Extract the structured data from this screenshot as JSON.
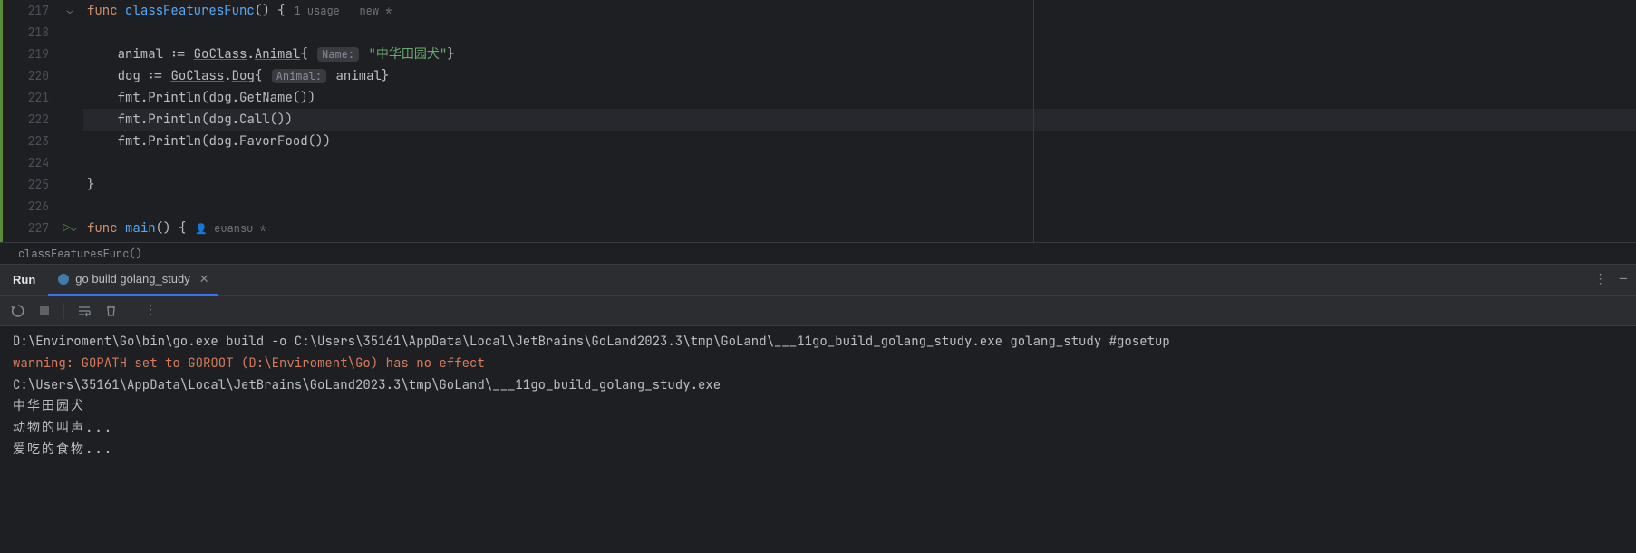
{
  "editor": {
    "lines": [
      217,
      218,
      219,
      220,
      221,
      222,
      223,
      224,
      225,
      226,
      227
    ],
    "current_line": 222,
    "func_decl": {
      "kw_func": "func",
      "name": "classFeaturesFunc",
      "parens": "()",
      "brace": "{",
      "usage": "1 usage",
      "status": "new *"
    },
    "l219": {
      "var": "animal",
      "assign": ":=",
      "pkg": "GoClass",
      "type": "Animal",
      "hint": "Name:",
      "str": "\"中华田园犬\""
    },
    "l220": {
      "var": "dog",
      "assign": ":=",
      "pkg": "GoClass",
      "type": "Dog",
      "hint": "Animal:",
      "val": "animal"
    },
    "l221": {
      "pkg": "fmt",
      "fn": "Println",
      "obj": "dog",
      "method": "GetName"
    },
    "l222": {
      "pkg": "fmt",
      "fn": "Println",
      "obj": "dog",
      "method": "Call"
    },
    "l223": {
      "pkg": "fmt",
      "fn": "Println",
      "obj": "dog",
      "method": "FavorFood"
    },
    "l225": {
      "brace": "}"
    },
    "l227": {
      "kw_func": "func",
      "name": "main",
      "parens": "()",
      "brace": "{",
      "author": "euansu *"
    }
  },
  "breadcrumb": "classFeaturesFunc()",
  "tool_window": {
    "title": "Run",
    "tab_label": "go build golang_study"
  },
  "console": {
    "lines": [
      {
        "cls": "out-normal",
        "text": "D:\\Enviroment\\Go\\bin\\go.exe build -o C:\\Users\\35161\\AppData\\Local\\JetBrains\\GoLand2023.3\\tmp\\GoLand\\___11go_build_golang_study.exe golang_study #gosetup"
      },
      {
        "cls": "out-warn",
        "text": "warning: GOPATH set to GOROOT (D:\\Enviroment\\Go) has no effect"
      },
      {
        "cls": "out-normal",
        "text": "C:\\Users\\35161\\AppData\\Local\\JetBrains\\GoLand2023.3\\tmp\\GoLand\\___11go_build_golang_study.exe"
      },
      {
        "cls": "out-normal highlight-cjk",
        "text": "中华田园犬"
      },
      {
        "cls": "out-normal highlight-cjk",
        "text": "动物的叫声..."
      },
      {
        "cls": "out-normal highlight-cjk",
        "text": "爱吃的食物..."
      }
    ]
  }
}
